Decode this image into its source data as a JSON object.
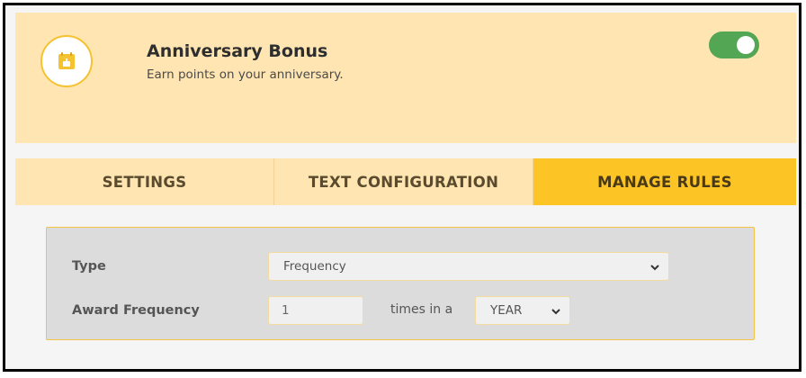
{
  "program": {
    "title": "Anniversary Bonus",
    "subtitle": "Earn points on your anniversary.",
    "icon": "calendar-cake-icon",
    "enabled": true
  },
  "tabs": [
    {
      "label": "SETTINGS",
      "active": false
    },
    {
      "label": "TEXT CONFIGURATION",
      "active": false
    },
    {
      "label": "MANAGE RULES",
      "active": true
    }
  ],
  "rules": {
    "type_label": "Type",
    "type_value": "Frequency",
    "award_label": "Award Frequency",
    "award_value": "1",
    "times_text": "times in a",
    "period_value": "YEAR"
  },
  "colors": {
    "header_bg": "#ffe5b2",
    "accent": "#fcc525",
    "toggle_on": "#53a653"
  }
}
